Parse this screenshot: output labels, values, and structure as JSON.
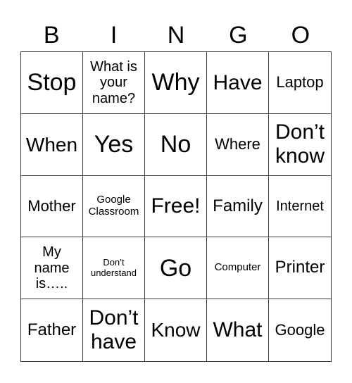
{
  "header": {
    "letters": [
      "B",
      "I",
      "N",
      "G",
      "O"
    ]
  },
  "cells": [
    "Stop",
    "What is your name?",
    "Why",
    "Have",
    "Laptop",
    "When",
    "Yes",
    "No",
    "Where",
    "Don’t know",
    "Mother",
    "Google Classroom",
    "Free!",
    "Family",
    "Internet",
    "My name is…..",
    "Don’t understand",
    "Go",
    "Computer",
    "Printer",
    "Father",
    "Don’t have",
    "Know",
    "What",
    "Google"
  ],
  "free_space": {
    "row": 3,
    "col": 3,
    "label": "Free!"
  }
}
